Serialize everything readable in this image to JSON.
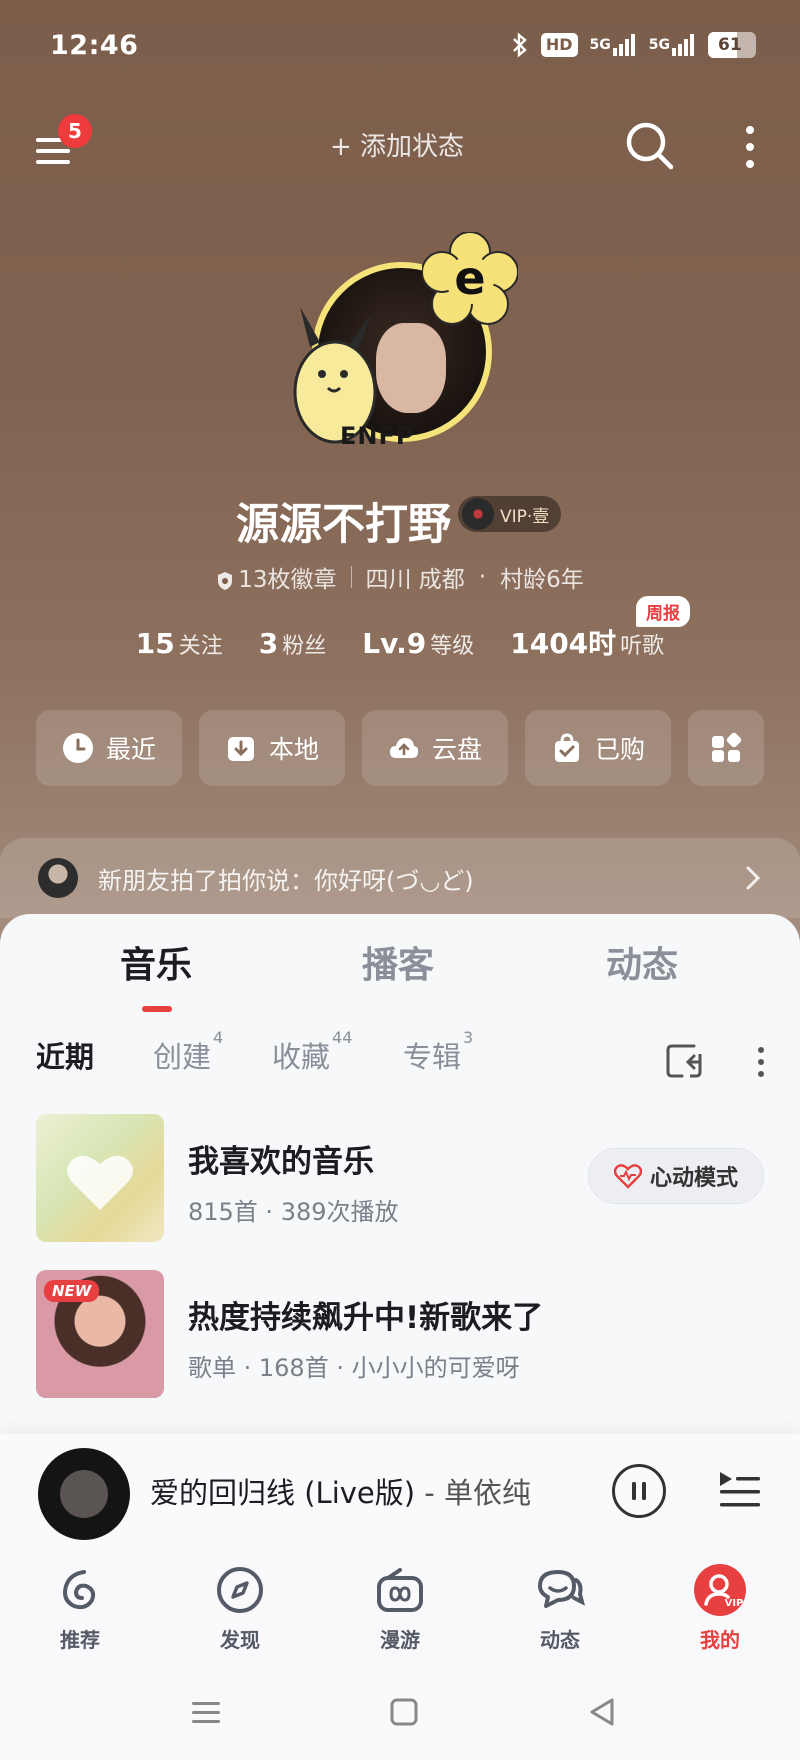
{
  "status_bar": {
    "time": "12:46",
    "hd_label": "HD",
    "net1": "5G",
    "net2": "5G",
    "battery": "61",
    "battery_level": 0.61
  },
  "top_nav": {
    "menu_badge": "5",
    "add_status": "+ 添加状态"
  },
  "profile": {
    "avatar_tag": "ENFP",
    "avatar_flower_letter": "e",
    "name": "源源不打野",
    "vip_label": "VIP·壹",
    "badges": "13枚徽章",
    "location": "四川 成都",
    "village_age": "村龄6年",
    "stats": [
      {
        "value": "15",
        "label": "关注"
      },
      {
        "value": "3",
        "label": "粉丝"
      },
      {
        "value": "Lv.9",
        "label": "等级"
      },
      {
        "value": "1404时",
        "label": "听歌"
      }
    ],
    "weekly_tag": "周报"
  },
  "quick_buttons": [
    {
      "label": "最近",
      "icon": "clock-icon"
    },
    {
      "label": "本地",
      "icon": "download-icon"
    },
    {
      "label": "云盘",
      "icon": "cloud-upload-icon"
    },
    {
      "label": "已购",
      "icon": "shopping-bag-icon"
    }
  ],
  "friend_banner": {
    "text": "新朋友拍了拍你说：你好呀(づ◡ど)"
  },
  "main_tabs": [
    "音乐",
    "播客",
    "动态"
  ],
  "sub_tabs": [
    {
      "label": "近期",
      "count": ""
    },
    {
      "label": "创建",
      "count": "4"
    },
    {
      "label": "收藏",
      "count": "44"
    },
    {
      "label": "专辑",
      "count": "3"
    }
  ],
  "playlists": [
    {
      "title": "我喜欢的音乐",
      "subtitle": "815首 · 389次播放",
      "action": "心动模式"
    },
    {
      "title": "热度持续飙升中!新歌来了",
      "subtitle": "歌单 · 168首 · 小小小的可爱呀",
      "tag": "NEW"
    }
  ],
  "mini_player": {
    "song": "爱的回归线 (Live版)",
    "artist": " - 单依纯"
  },
  "bottom_nav": [
    {
      "label": "推荐",
      "icon": "netease-logo-icon"
    },
    {
      "label": "发现",
      "icon": "compass-icon"
    },
    {
      "label": "漫游",
      "icon": "radio-icon"
    },
    {
      "label": "动态",
      "icon": "chat-bubbles-icon"
    },
    {
      "label": "我的",
      "icon": "user-vip-icon"
    }
  ],
  "colors": {
    "accent": "#e84040",
    "hero_bg": "#7c5e4b"
  }
}
